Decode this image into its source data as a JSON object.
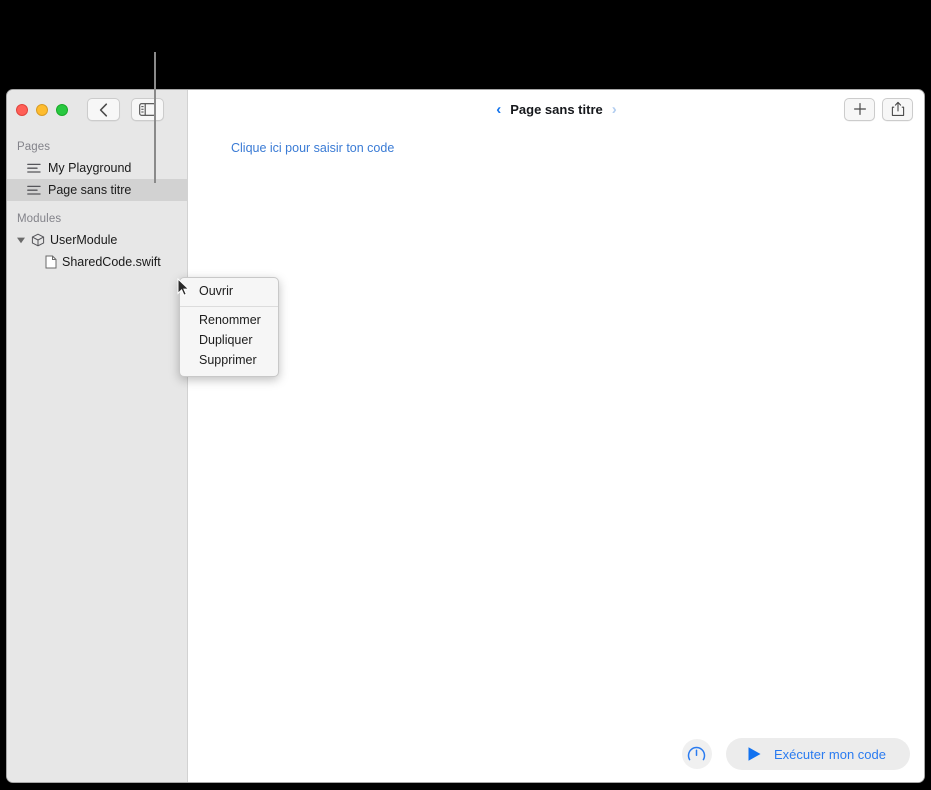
{
  "window": {
    "traffic_lights": [
      "close",
      "minimize",
      "zoom"
    ],
    "back_button_icon": "chevron-left-icon",
    "sidebar_toggle_icon": "sidebar-toggle-icon"
  },
  "sidebar": {
    "sections": [
      {
        "header": "Pages",
        "items": [
          {
            "label": "My Playground",
            "icon": "page-lines-icon",
            "selected": false
          },
          {
            "label": "Page sans titre",
            "icon": "page-lines-icon",
            "selected": true
          }
        ]
      },
      {
        "header": "Modules",
        "items": [
          {
            "label": "UserModule",
            "icon": "cube-icon",
            "disclosure": "disclosure-triangle-open-icon",
            "selected": false
          },
          {
            "label": "SharedCode.swift",
            "icon": "swift-file-icon",
            "selected": false
          }
        ]
      }
    ]
  },
  "toolbar": {
    "prev_chevron": "‹",
    "next_chevron": "›",
    "doc_title": "Page sans titre",
    "add_label": "+",
    "add_icon": "plus-icon",
    "share_icon": "share-icon"
  },
  "editor": {
    "placeholder_link": "Clique ici pour saisir ton code"
  },
  "bottom": {
    "gauge_icon": "speedometer-icon",
    "run_icon": "play-triangle-icon",
    "run_label": "Exécuter mon code"
  },
  "context_menu": {
    "primary": [
      "Ouvrir"
    ],
    "secondary": [
      "Renommer",
      "Dupliquer",
      "Supprimer"
    ]
  },
  "colors": {
    "accent_blue": "#2a7bf0",
    "link_blue": "#3a7bd5",
    "sidebar_bg": "#e7e7e7",
    "selected_row": "#d2d2d2",
    "traffic_red": "#ff5f57",
    "traffic_yellow": "#febc2e",
    "traffic_green": "#28c840"
  }
}
